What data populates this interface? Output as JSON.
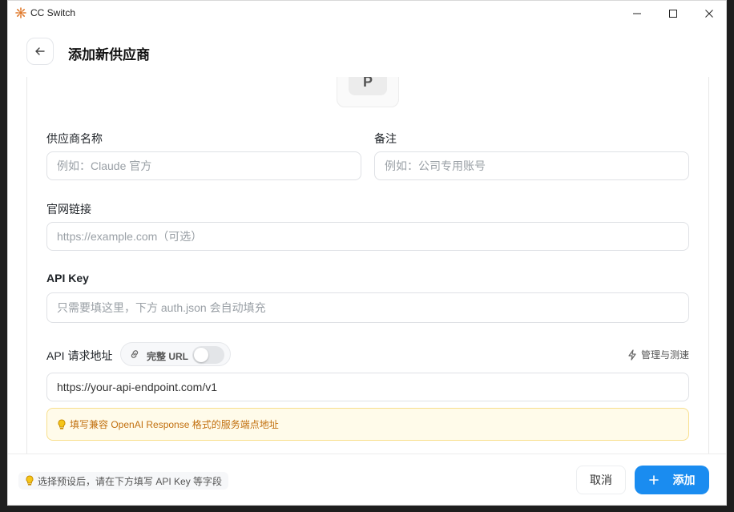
{
  "window": {
    "title": "CC Switch",
    "icon": "sun-logo-icon"
  },
  "header": {
    "title": "添加新供应商"
  },
  "logo": {
    "letter": "P"
  },
  "form": {
    "provider_name": {
      "label": "供应商名称",
      "placeholder": "例如：Claude 官方"
    },
    "notes": {
      "label": "备注",
      "placeholder": "例如：公司专用账号"
    },
    "website": {
      "label": "官网链接",
      "placeholder": "https://example.com（可选）"
    },
    "api_key": {
      "label": "API Key",
      "placeholder": "只需要填这里，下方 auth.json 会自动填充"
    },
    "endpoint": {
      "label": "API 请求地址",
      "full_url_label": "完整 URL",
      "full_url_enabled": false,
      "manage_label": "管理与测速",
      "value": "https://your-api-endpoint.com/v1",
      "hint": "填写兼容 OpenAI Response 格式的服务端点地址"
    }
  },
  "footer": {
    "hint": "选择预设后，请在下方填写 API Key 等字段",
    "cancel_label": "取消",
    "add_label": "添加"
  },
  "colors": {
    "accent": "#1a8cf0",
    "hint_bg": "#fffbea",
    "hint_text": "#c2700f"
  }
}
